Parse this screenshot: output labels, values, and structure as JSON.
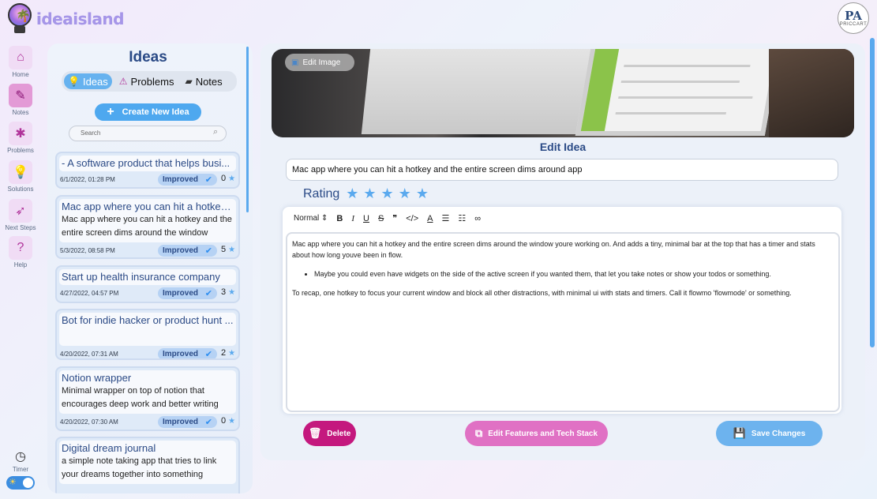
{
  "app": {
    "name": "ideaisland",
    "avatar_monogram": "PA",
    "avatar_brand": "PRICCART"
  },
  "nav": {
    "items": [
      {
        "label": "Home",
        "icon": "home-icon"
      },
      {
        "label": "Notes",
        "icon": "notes-icon"
      },
      {
        "label": "Problems",
        "icon": "bug-icon"
      },
      {
        "label": "Solutions",
        "icon": "lightbulb-icon"
      },
      {
        "label": "Next Steps",
        "icon": "rocket-icon"
      },
      {
        "label": "Help",
        "icon": "help-icon"
      }
    ],
    "timer_label": "Timer"
  },
  "ideas": {
    "title": "Ideas",
    "tabs": [
      {
        "label": "Ideas",
        "icon": "lightbulb-icon"
      },
      {
        "label": "Problems",
        "icon": "warning-icon"
      },
      {
        "label": "Notes",
        "icon": "note-icon"
      }
    ],
    "create_label": "Create New Idea",
    "search_placeholder": "Search",
    "cards": [
      {
        "title": "- A software product that helps busi...",
        "desc": "",
        "date": "6/1/2022, 01:28 PM",
        "badge": "Improved",
        "count": "0"
      },
      {
        "title": "Mac app where you can hit a hotkey ...",
        "desc": "Mac app where you can hit a hotkey and the entire screen dims around the window",
        "date": "5/3/2022, 08:58 PM",
        "badge": "Improved",
        "count": "5"
      },
      {
        "title": "Start up health insurance company",
        "desc": "",
        "date": "4/27/2022, 04:57 PM",
        "badge": "Improved",
        "count": "3"
      },
      {
        "title": "Bot for indie hacker or product hunt ...",
        "desc": "",
        "date": "4/20/2022, 07:31 AM",
        "badge": "Improved",
        "count": "2"
      },
      {
        "title": "Notion wrapper",
        "desc": "Minimal wrapper on top of notion that encourages deep work and better writing",
        "date": "4/20/2022, 07:30 AM",
        "badge": "Improved",
        "count": "0"
      },
      {
        "title": "Digital dream journal",
        "desc": "a simple note taking app that tries to link your dreams together into something",
        "date": "",
        "badge": "",
        "count": ""
      }
    ]
  },
  "editor": {
    "edit_image_label": "Edit Image",
    "heading": "Edit Idea",
    "title_value": "Mac app where you can hit a hotkey and the entire screen dims around app",
    "rating_label": "Rating",
    "rating_value": 5,
    "rating_max": 5,
    "toolbar_format": "Normal",
    "content_p1": "Mac app where you can hit a hotkey and the entire screen dims around the window youre working on. And adds a tiny, minimal bar at the top that has a timer and stats about how long youve been in flow.",
    "content_bullet": "Maybe you could even have widgets on the side of the active screen if you wanted them, that let you take notes or show your todos or something.",
    "content_p2": "To recap, one hotkey to focus your current window and block all other distractions, with minimal ui with stats and timers. Call it flowmo 'flowmode' or something.",
    "delete_label": "Delete",
    "features_label": "Edit Features and Tech Stack",
    "save_label": "Save Changes"
  },
  "colors": {
    "accent_blue": "#5aa9ee",
    "delete": "#c4187e",
    "features": "#e071c4",
    "title": "#2a4a86"
  }
}
